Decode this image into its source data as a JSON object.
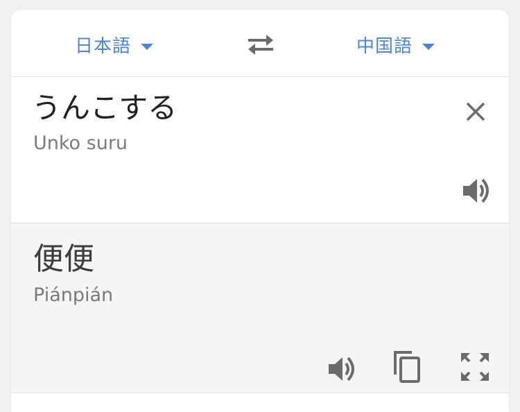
{
  "languages": {
    "source": "日本語",
    "target": "中国語"
  },
  "source": {
    "text": "うんこする",
    "transliteration": "Unko suru"
  },
  "target": {
    "text": "便便",
    "transliteration": "Piánpián"
  },
  "icons": {
    "swap": "swap-arrows-icon",
    "clear": "close-icon",
    "listen_source": "speaker-icon",
    "listen_target": "speaker-icon",
    "copy": "copy-icon",
    "fullscreen": "fullscreen-icon"
  },
  "colors": {
    "accent": "#4c83d8",
    "icon": "#6b6b6b",
    "target_bg": "#f5f5f5"
  }
}
